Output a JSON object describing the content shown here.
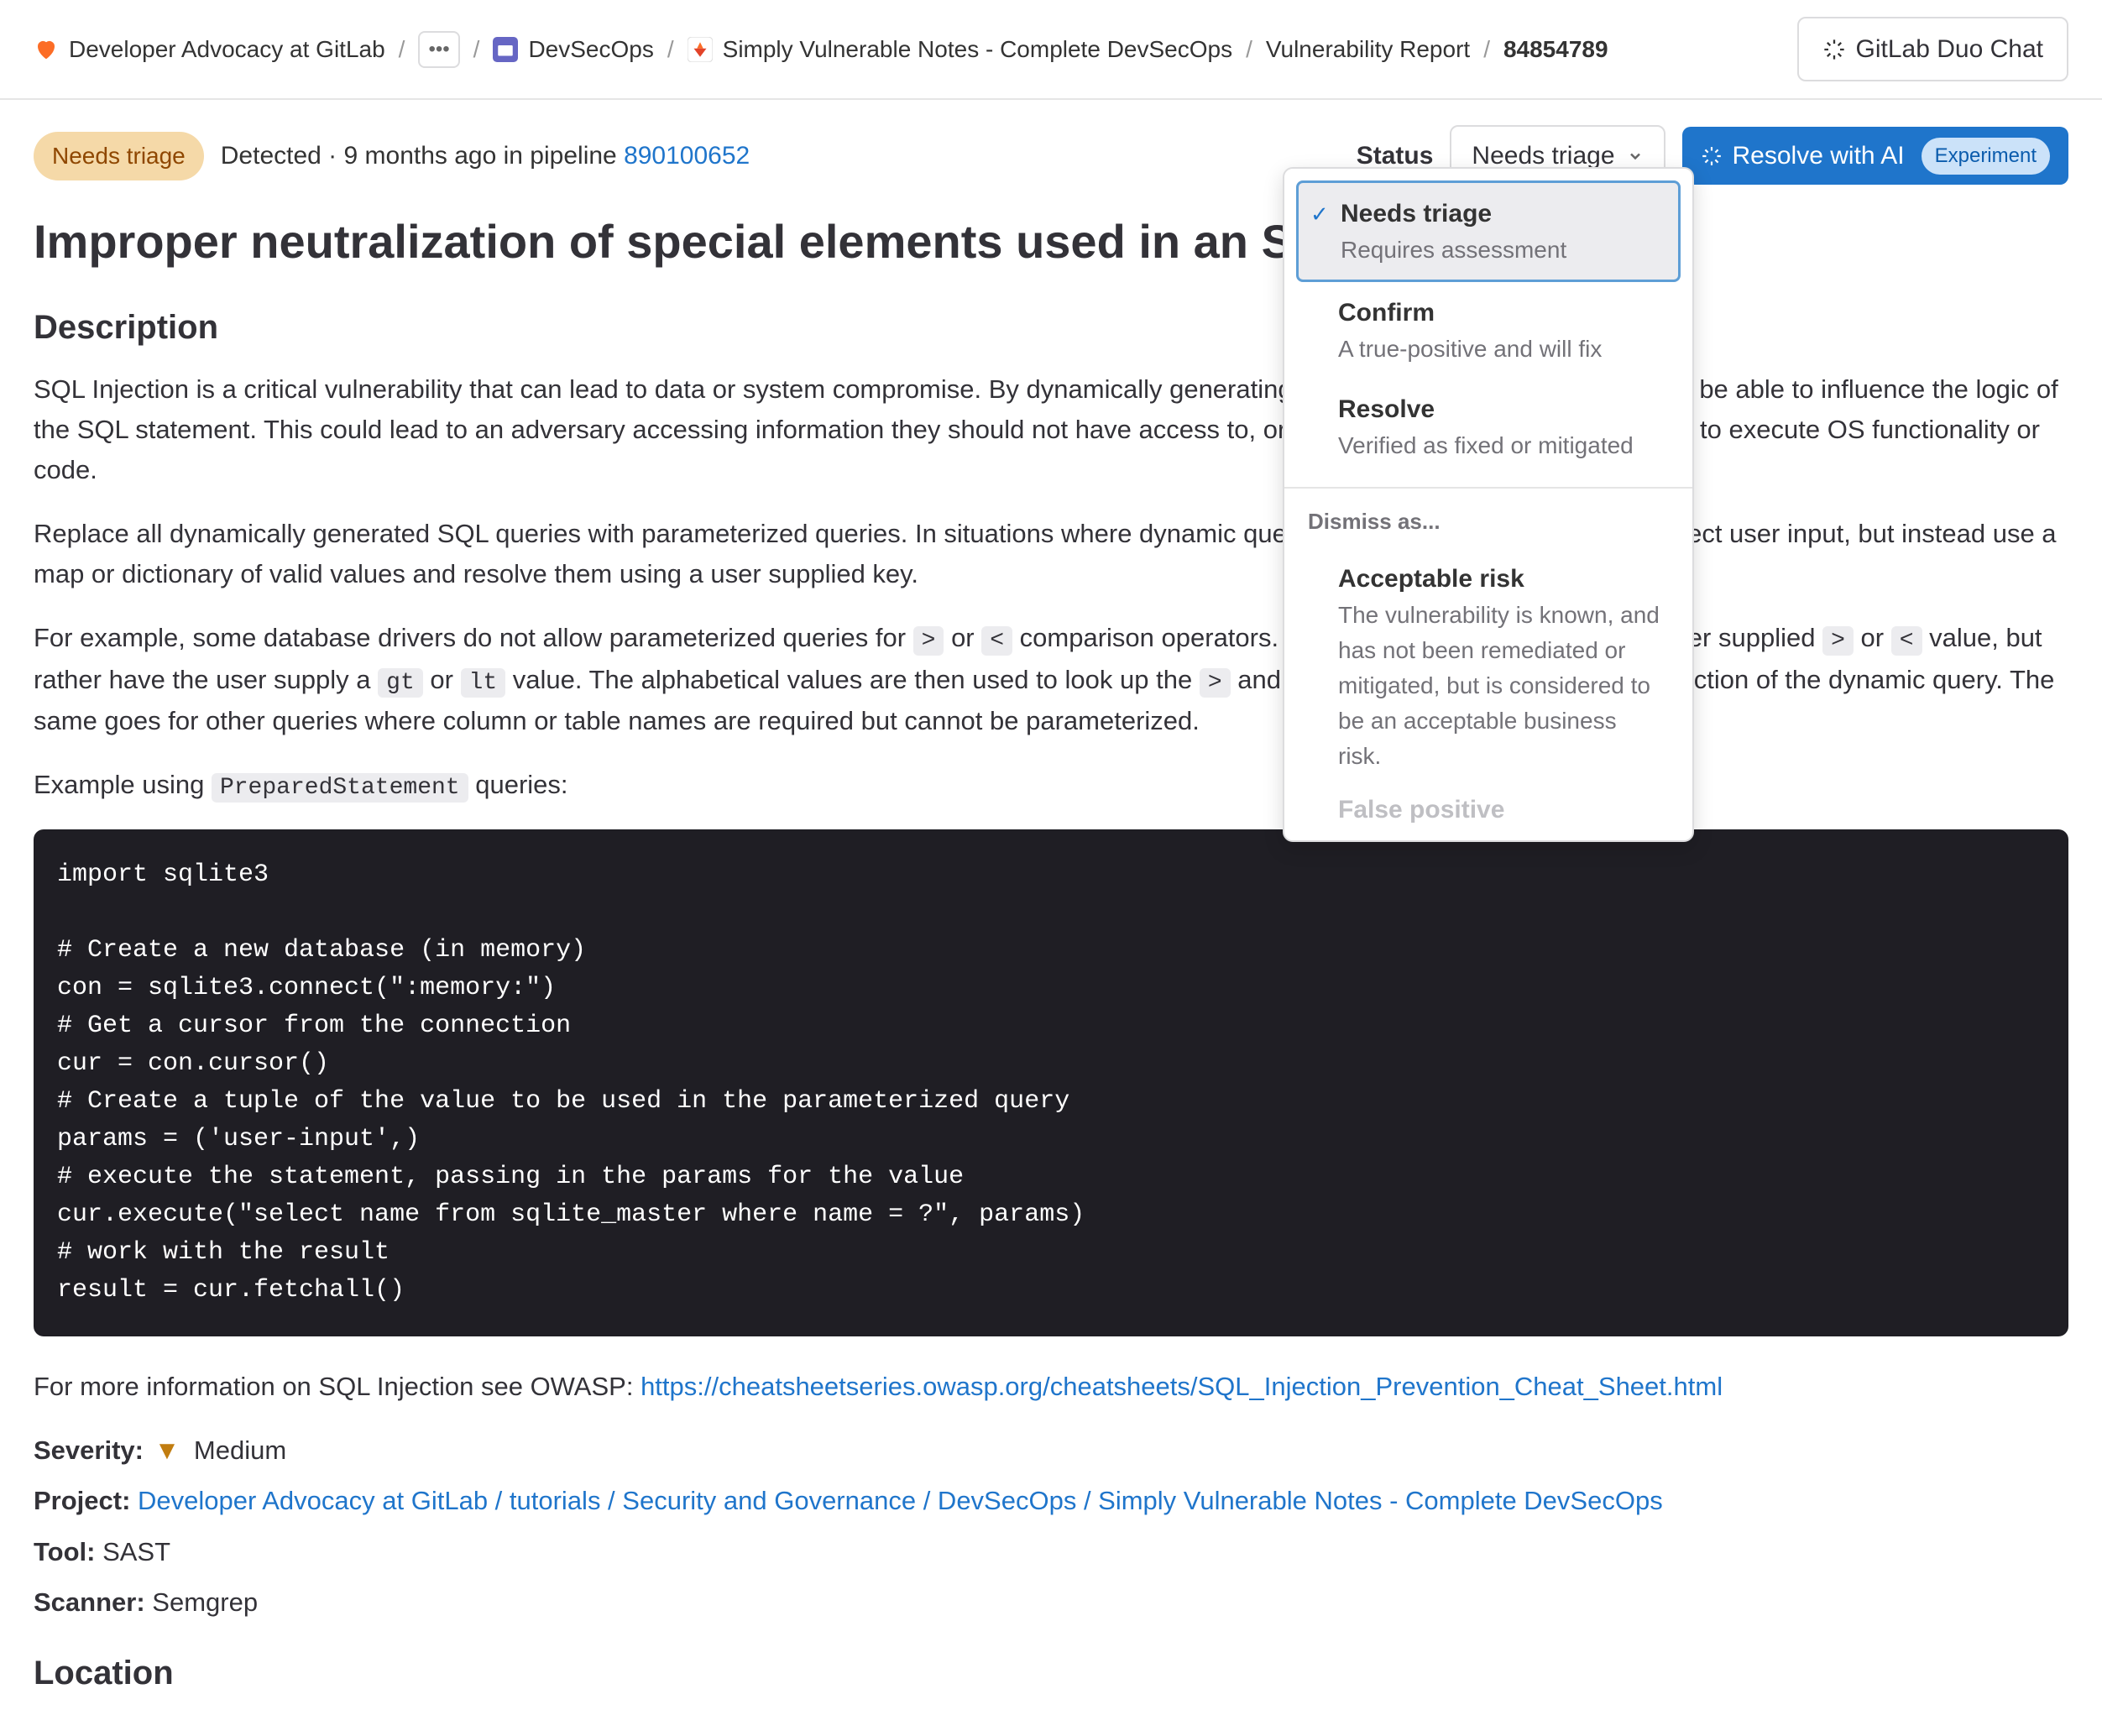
{
  "breadcrumbs": {
    "items": [
      {
        "label": "Developer Advocacy at GitLab"
      },
      {
        "label": "DevSecOps"
      },
      {
        "label": "Simply Vulnerable Notes - Complete DevSecOps"
      },
      {
        "label": "Vulnerability Report"
      },
      {
        "label": "84854789"
      }
    ]
  },
  "header": {
    "duo_chat": "GitLab Duo Chat"
  },
  "status_bar": {
    "badge": "Needs triage",
    "detected_prefix": "Detected · 9 months ago in pipeline ",
    "pipeline_id": "890100652",
    "status_label": "Status",
    "dropdown_label": "Needs triage",
    "resolve_ai": "Resolve with AI",
    "experiment": "Experiment"
  },
  "title": "Improper neutralization of special elements used in an SQL Command",
  "sections": {
    "description": "Description",
    "location": "Location"
  },
  "desc": {
    "p1": "SQL Injection is a critical vulnerability that can lead to data or system compromise. By dynamically generating SQL query strings, user input may be able to influence the logic of the SQL statement. This could lead to an adversary accessing information they should not have access to, or in some circumstances, being able to execute OS functionality or code.",
    "p2": "Replace all dynamically generated SQL queries with parameterized queries. In situations where dynamic queries must be created, never use direct user input, but instead use a map or dictionary of valid values and resolve them using a user supplied key.",
    "p3a": "For example, some database drivers do not allow parameterized queries for ",
    "p3b": " or ",
    "p3c": " comparison operators. In these situations, do not use a user supplied ",
    "p3d": " or ",
    "p3e": " value, but rather have the user supply a ",
    "p3f": " or ",
    "p3g": " value. The alphabetical values are then used to look up the ",
    "p3h": " and ",
    "p3i": " values to be used in the construction of the dynamic query. The same goes for other queries where column or table names are required but cannot be parameterized.",
    "p4a": "Example using ",
    "p4b": " queries:",
    "codes": {
      "gt_sym": ">",
      "lt_sym": "<",
      "gt": "gt",
      "lt": "lt",
      "prepared": "PreparedStatement"
    },
    "more_info_prefix": "For more information on SQL Injection see OWASP: ",
    "more_info_link": "https://cheatsheetseries.owasp.org/cheatsheets/SQL_Injection_Prevention_Cheat_Sheet.html"
  },
  "code_block": "import sqlite3\n\n# Create a new database (in memory)\ncon = sqlite3.connect(\":memory:\")\n# Get a cursor from the connection\ncur = con.cursor()\n# Create a tuple of the value to be used in the parameterized query\nparams = ('user-input',)\n# execute the statement, passing in the params for the value\ncur.execute(\"select name from sqlite_master where name = ?\", params)\n# work with the result\nresult = cur.fetchall()",
  "meta": {
    "severity_label": "Severity:",
    "severity_value": "Medium",
    "project_label": "Project:",
    "project_value": "Developer Advocacy at GitLab / tutorials / Security and Governance / DevSecOps / Simply Vulnerable Notes - Complete DevSecOps",
    "tool_label": "Tool:",
    "tool_value": "SAST",
    "scanner_label": "Scanner:",
    "scanner_value": "Semgrep"
  },
  "dropdown": {
    "items": [
      {
        "title": "Needs triage",
        "sub": "Requires assessment",
        "selected": true
      },
      {
        "title": "Confirm",
        "sub": "A true-positive and will fix",
        "selected": false
      },
      {
        "title": "Resolve",
        "sub": "Verified as fixed or mitigated",
        "selected": false
      }
    ],
    "dismiss_label": "Dismiss as...",
    "dismiss_items": [
      {
        "title": "Acceptable risk",
        "sub": "The vulnerability is known, and has not been remediated or mitigated, but is considered to be an acceptable business risk."
      }
    ],
    "faded_next": "False positive"
  }
}
